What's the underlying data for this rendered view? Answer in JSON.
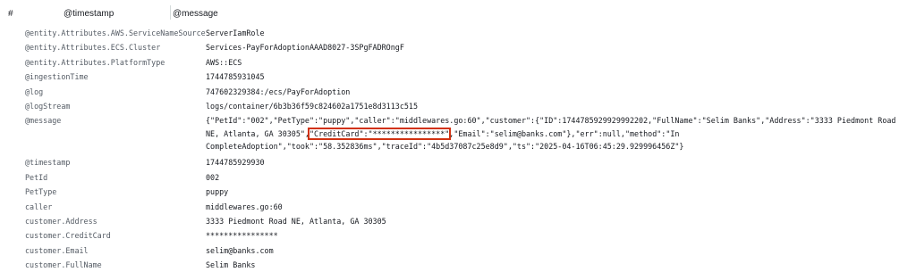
{
  "header": {
    "hash": "#",
    "timestamp": "@timestamp",
    "message": "@message"
  },
  "fields": [
    {
      "key": "@entity.Attributes.AWS.ServiceNameSource",
      "value": "ServerIamRole"
    },
    {
      "key": "@entity.Attributes.ECS.Cluster",
      "value": "Services-PayForAdoptionAAAD8027-3SPgFADROngF"
    },
    {
      "key": "@entity.Attributes.PlatformType",
      "value": "AWS::ECS"
    },
    {
      "key": "@ingestionTime",
      "value": "1744785931045"
    },
    {
      "key": "@log",
      "value": "747602329384:/ecs/PayForAdoption"
    },
    {
      "key": "@logStream",
      "value": "logs/container/6b3b36f59c824602a1751e8d3113c515"
    },
    {
      "key": "@message",
      "value_before": "{\"PetId\":\"002\",\"PetType\":\"puppy\",\"caller\":\"middlewares.go:60\",\"customer\":{\"ID\":1744785929929992202,\"FullName\":\"Selim Banks\",\"Address\":\"3333 Piedmont Road NE, Atlanta, GA 30305\",",
      "value_highlight": "\"CreditCard\":\"****************\"",
      "value_after": ",\"Email\":\"selim@banks.com\"},\"err\":null,\"method\":\"In CompleteAdoption\",\"took\":\"58.352836ms\",\"traceId\":\"4b5d37087c25e8d9\",\"ts\":\"2025-04-16T06:45:29.929996456Z\"}"
    },
    {
      "key": "@timestamp",
      "value": "1744785929930"
    },
    {
      "key": "PetId",
      "value": "002"
    },
    {
      "key": "PetType",
      "value": "puppy"
    },
    {
      "key": "caller",
      "value": "middlewares.go:60"
    },
    {
      "key": "customer.Address",
      "value": "3333 Piedmont Road NE, Atlanta, GA 30305"
    },
    {
      "key": "customer.CreditCard",
      "value": "****************"
    },
    {
      "key": "customer.Email",
      "value": "selim@banks.com"
    },
    {
      "key": "customer.FullName",
      "value": "Selim Banks"
    }
  ],
  "colors": {
    "highlight_box": "#d13212",
    "key_text": "#545b64",
    "value_text": "#16191f"
  }
}
